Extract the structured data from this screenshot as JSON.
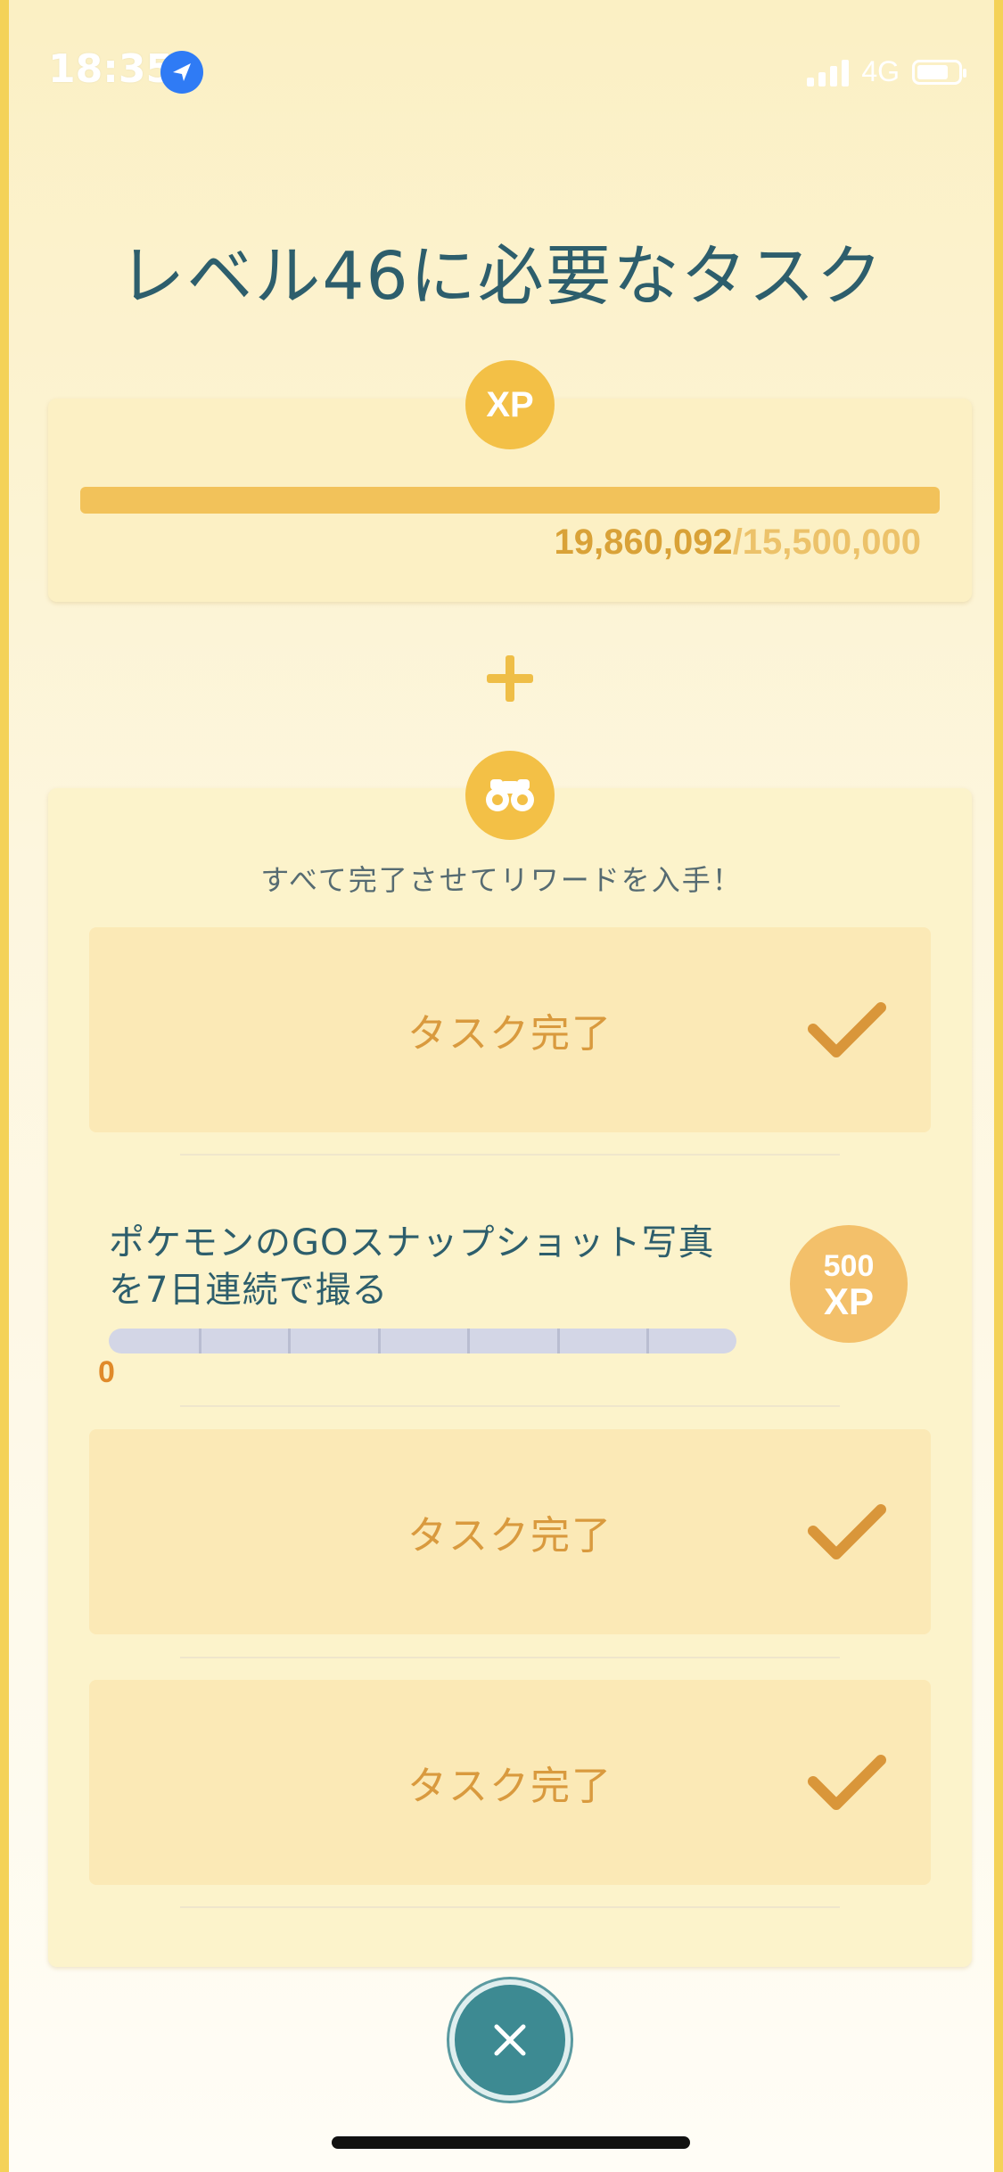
{
  "status_bar": {
    "time": "18:35",
    "network": "4G"
  },
  "title": "レベル46に必要なタスク",
  "xp": {
    "badge": "XP",
    "current": "19,860,092",
    "separator_total": "/15,500,000",
    "progress_fraction": 1.0
  },
  "tasks": {
    "subtitle": "すべて完了させてリワードを入手！",
    "done_label": "タスク完了",
    "active_task": {
      "description": "ポケモンのGOスナップショット写真を7日連続で撮る",
      "reward_amount": "500",
      "reward_unit": "XP",
      "progress_value": "0",
      "progress_fraction": 0,
      "segments": 7
    }
  },
  "colors": {
    "accent_gold": "#f3c046",
    "title_teal": "#2d5e6c",
    "done_orange": "#d99a3e",
    "close_teal": "#3d8a92"
  },
  "icons": {
    "location": "location-arrow-icon",
    "xp_badge": "xp-badge-icon",
    "binoculars": "binoculars-icon",
    "checkmark": "checkmark-icon",
    "close": "close-icon"
  }
}
